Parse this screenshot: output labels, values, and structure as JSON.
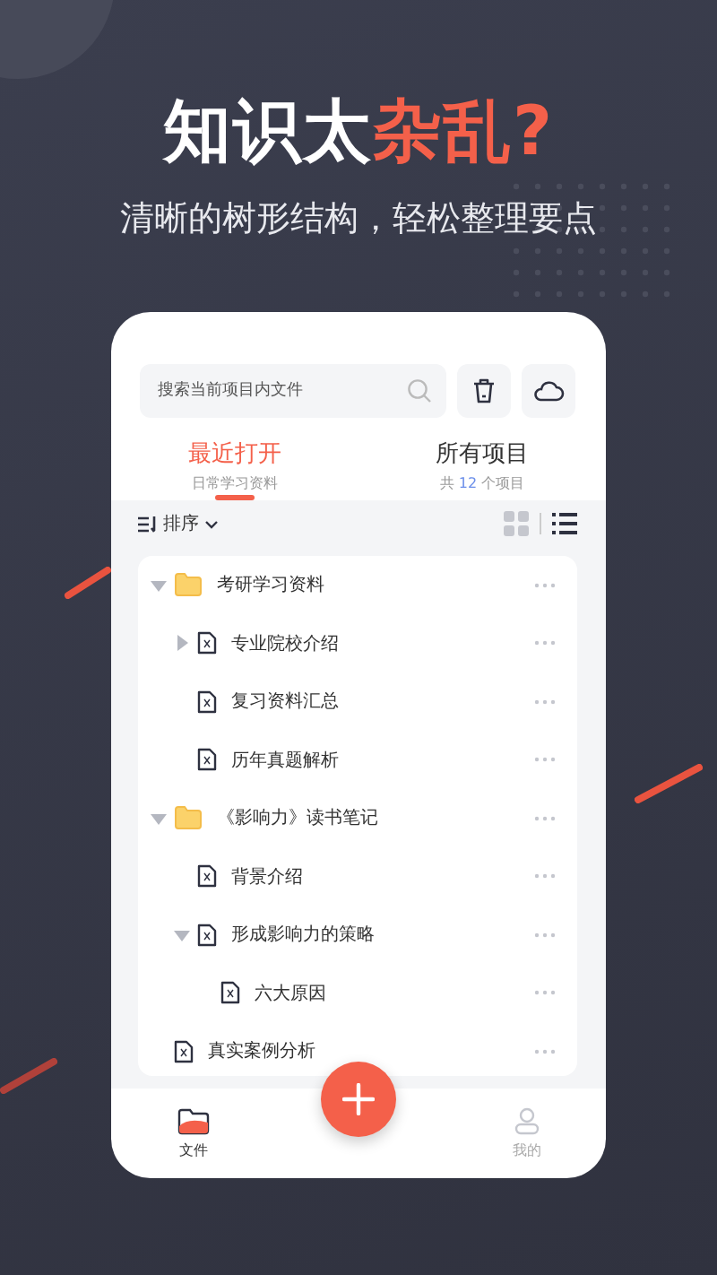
{
  "headline": {
    "plain": "知识太",
    "accent": "杂乱?"
  },
  "subheadline": "清晰的树形结构，轻松整理要点",
  "search": {
    "placeholder": "搜索当前项目内文件"
  },
  "tabs": [
    {
      "label": "最近打开",
      "caption": "日常学习资料",
      "selected": true
    },
    {
      "label": "所有项目",
      "caption": "共",
      "count": "12",
      "caption_end": "个项目",
      "selected": false
    }
  ],
  "sort": {
    "label": "排序"
  },
  "views": [
    {
      "kind": "grid",
      "selected": false
    },
    {
      "kind": "list",
      "selected": true
    }
  ],
  "tree": [
    {
      "name": "考研学习资料",
      "kind": "folder",
      "expanded": true,
      "children": [
        {
          "name": "专业院校介绍",
          "kind": "file",
          "expanded": false
        },
        {
          "name": "复习资料汇总",
          "kind": "file"
        },
        {
          "name": "历年真题解析",
          "kind": "file"
        }
      ]
    },
    {
      "name": "《影响力》读书笔记",
      "kind": "folder",
      "expanded": true,
      "children": [
        {
          "name": "背景介绍",
          "kind": "file"
        },
        {
          "name": "形成影响力的策略",
          "kind": "file",
          "expanded": true,
          "children": [
            {
              "name": "六大原因",
              "kind": "file"
            }
          ]
        }
      ]
    },
    {
      "name": "真实案例分析",
      "kind": "file"
    }
  ],
  "nav": [
    {
      "label": "文件",
      "kind": "files",
      "selected": true
    },
    {
      "label": "我的",
      "kind": "profile",
      "selected": false
    }
  ]
}
